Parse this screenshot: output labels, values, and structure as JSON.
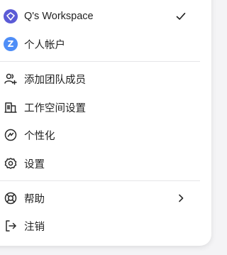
{
  "workspaces": [
    {
      "label": "Q's Workspace",
      "icon": "workspace-diamond-icon",
      "color": "#5b5bd6",
      "selected": true
    },
    {
      "label": "个人帐户",
      "icon": "personal-account-avatar",
      "avatar_letter": "Z",
      "color": "#4f8ef7",
      "selected": false
    }
  ],
  "menu": {
    "add_member": "添加团队成员",
    "workspace_settings": "工作空间设置",
    "personalize": "个性化",
    "settings": "设置",
    "help": "帮助",
    "logout": "注销"
  }
}
